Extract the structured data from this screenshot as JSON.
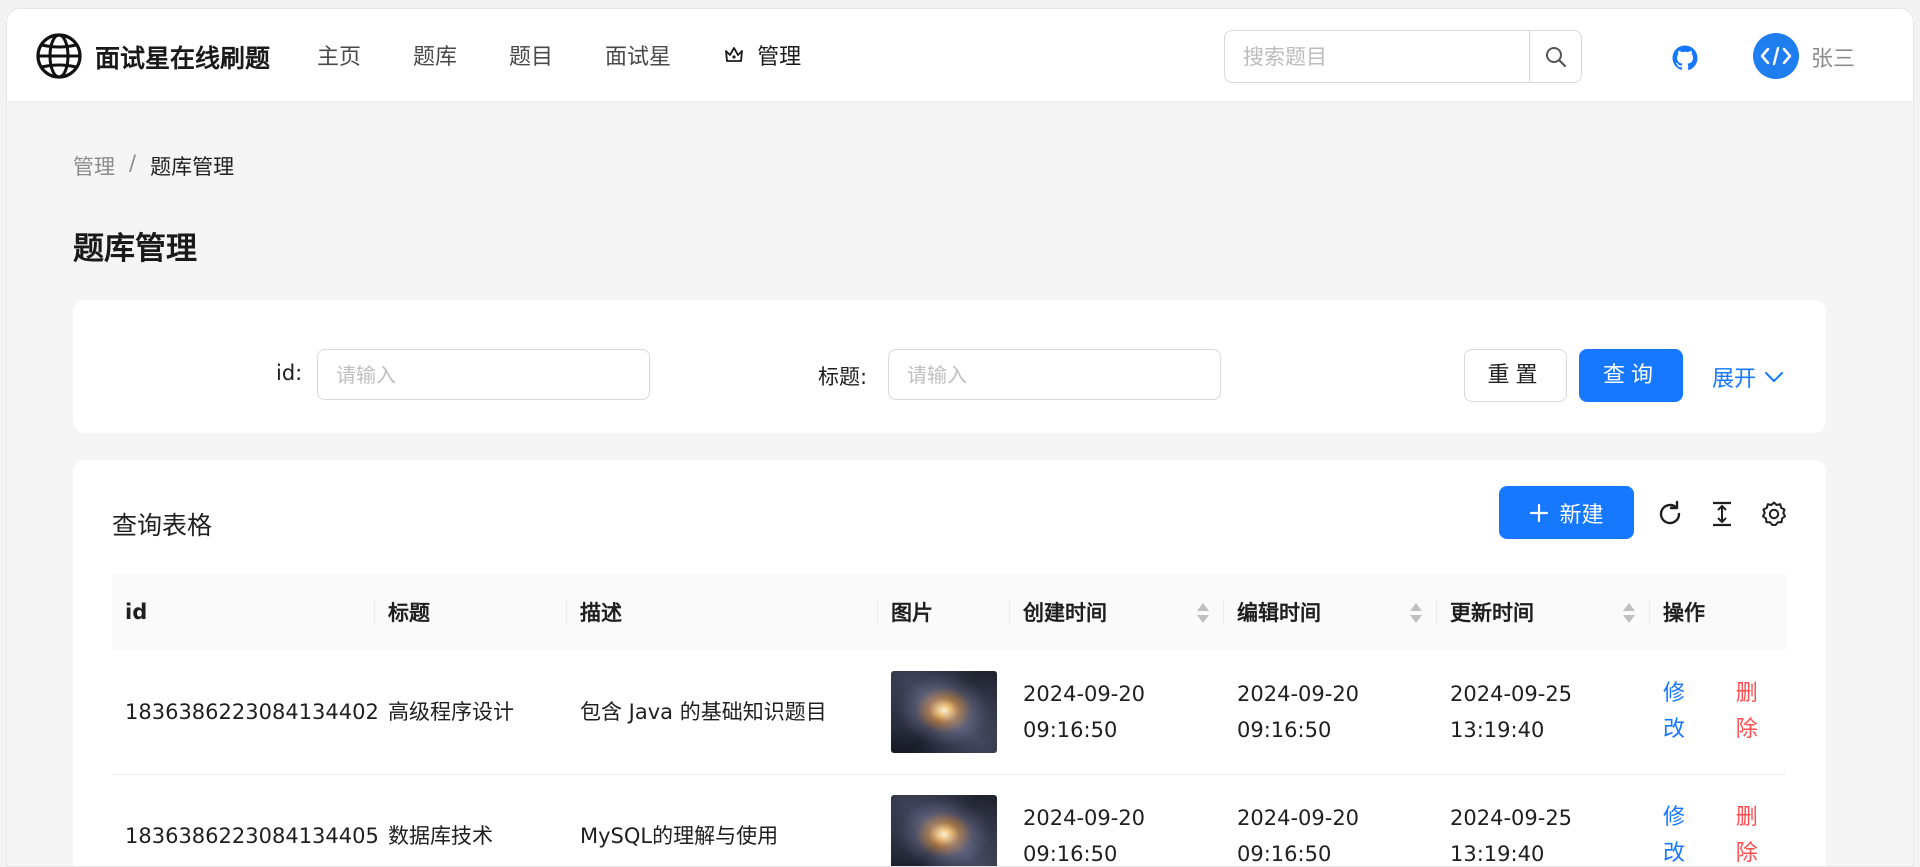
{
  "header": {
    "site_title": "面试星在线刷题",
    "nav": [
      "主页",
      "题库",
      "题目",
      "面试星"
    ],
    "manage_label": "管理",
    "search_placeholder": "搜索题目",
    "username": "张三"
  },
  "breadcrumb": {
    "parent": "管理",
    "separator": "/",
    "current": "题库管理"
  },
  "page_title": "题库管理",
  "filter": {
    "id_label": "id:",
    "id_placeholder": "请输入",
    "title_label": "标题:",
    "title_placeholder": "请输入",
    "reset_label": "重置",
    "query_label": "查询",
    "expand_label": "展开"
  },
  "table": {
    "title": "查询表格",
    "new_label": "新建",
    "columns": [
      "id",
      "标题",
      "描述",
      "图片",
      "创建时间",
      "编辑时间",
      "更新时间",
      "操作"
    ],
    "edit_label": [
      "修",
      "改"
    ],
    "delete_label": [
      "删",
      "除"
    ],
    "rows": [
      {
        "id": "1836386223084134402",
        "title": "高级程序设计",
        "description": "包含 Java 的基础知识题目",
        "created_date": "2024-09-20",
        "created_time": "09:16:50",
        "edited_date": "2024-09-20",
        "edited_time": "09:16:50",
        "updated_date": "2024-09-25",
        "updated_time": "13:19:40"
      },
      {
        "id": "1836386223084134405",
        "title": "数据库技术",
        "description": "MySQL的理解与使用",
        "created_date": "2024-09-20",
        "created_time": "09:16:50",
        "edited_date": "2024-09-20",
        "edited_time": "09:16:50",
        "updated_date": "2024-09-25",
        "updated_time": "13:19:40"
      }
    ]
  },
  "icons": {
    "logo": "globe-icon",
    "manage": "crown-icon",
    "search": "search-icon",
    "github": "github-icon",
    "avatar": "code-avatar-icon",
    "expand": "chevron-down-icon",
    "new": "plus-icon",
    "reload": "reload-icon",
    "density": "column-height-icon",
    "settings": "gear-icon"
  },
  "colors": {
    "primary": "#1677ff",
    "danger": "#ff4d4f",
    "background": "#f5f5f5"
  }
}
